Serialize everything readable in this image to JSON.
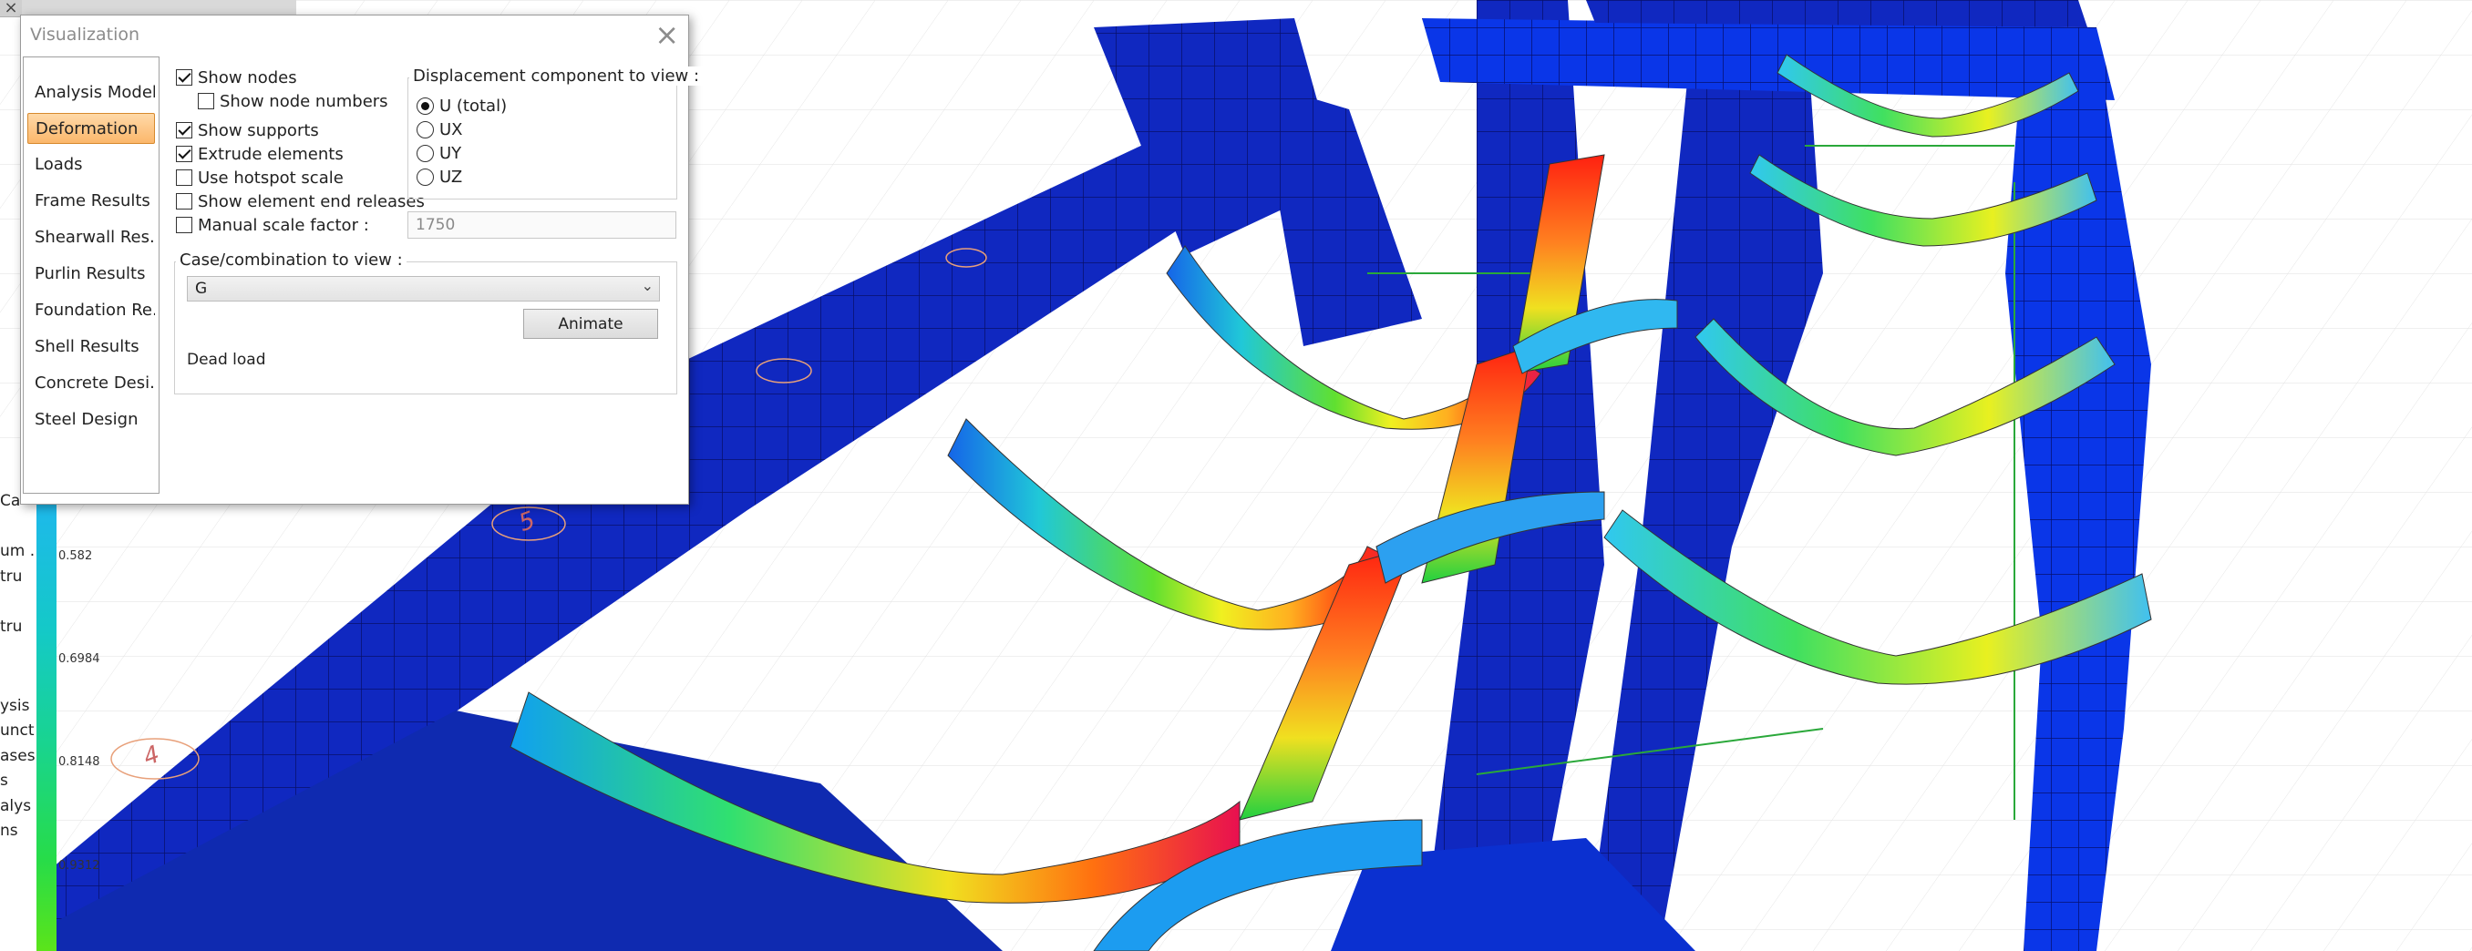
{
  "window": {
    "title": "Visualization"
  },
  "nav": {
    "items": [
      {
        "label": "Analysis Model",
        "active": false
      },
      {
        "label": "Deformation",
        "active": true
      },
      {
        "label": "Loads",
        "active": false
      },
      {
        "label": "Frame Results",
        "active": false
      },
      {
        "label": "Shearwall Res...",
        "active": false
      },
      {
        "label": "Purlin Results",
        "active": false
      },
      {
        "label": "Foundation Re...",
        "active": false
      },
      {
        "label": "Shell Results",
        "active": false
      },
      {
        "label": "Concrete Desi...",
        "active": false
      },
      {
        "label": "Steel Design",
        "active": false
      }
    ]
  },
  "options": {
    "show_nodes": {
      "label": "Show nodes",
      "checked": true
    },
    "show_node_numbers": {
      "label": "Show node numbers",
      "checked": false
    },
    "show_supports": {
      "label": "Show supports",
      "checked": true
    },
    "extrude_elements": {
      "label": "Extrude elements",
      "checked": true
    },
    "use_hotspot_scale": {
      "label": "Use hotspot scale",
      "checked": false
    },
    "show_end_releases": {
      "label": "Show element end releases",
      "checked": false
    },
    "manual_scale": {
      "label": "Manual scale factor :",
      "checked": false,
      "value": "1750"
    }
  },
  "displacement": {
    "title": "Displacement component to view :",
    "options": [
      {
        "label": "U (total)",
        "selected": true
      },
      {
        "label": "UX",
        "selected": false
      },
      {
        "label": "UY",
        "selected": false
      },
      {
        "label": "UZ",
        "selected": false
      }
    ]
  },
  "case": {
    "title": "Case/combination to view :",
    "selected": "G",
    "animate_label": "Animate",
    "description": "Dead load"
  },
  "legend": {
    "values": [
      "0.582",
      "0.6984",
      "0.8148",
      "0.9312"
    ]
  },
  "background_panel": {
    "fragments": [
      "Ca",
      "um .",
      "tru",
      "tru",
      "ysis",
      "unct",
      "ases",
      "s",
      "alys",
      "ns"
    ]
  },
  "grid_labels": [
    "5",
    "4"
  ],
  "colors": {
    "accent_nav": "#fbb76b",
    "structure_blue": "#1020c8",
    "deform_red": "#e8202a"
  }
}
